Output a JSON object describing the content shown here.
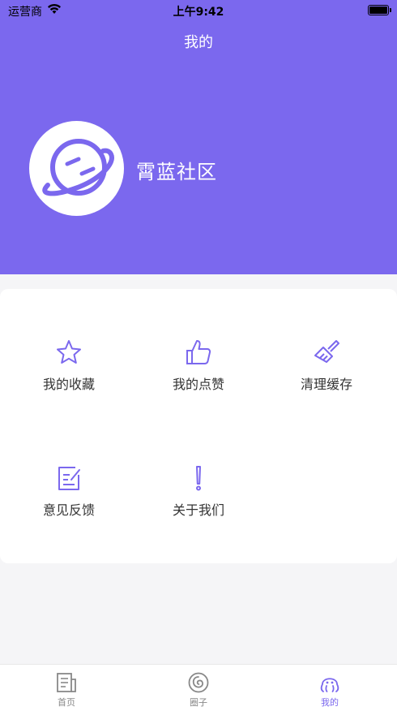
{
  "status_bar": {
    "carrier": "运营商",
    "time": "上午9:42"
  },
  "header": {
    "title": "我的",
    "background_color": "#7b68ee"
  },
  "profile": {
    "name": "霄蓝社区",
    "avatar_icon": "planet-face-icon"
  },
  "menu": {
    "items": [
      {
        "label": "我的收藏",
        "icon": "star-icon"
      },
      {
        "label": "我的点赞",
        "icon": "thumbs-up-icon"
      },
      {
        "label": "清理缓存",
        "icon": "brush-icon"
      },
      {
        "label": "意见反馈",
        "icon": "feedback-icon"
      },
      {
        "label": "关于我们",
        "icon": "exclamation-icon"
      }
    ]
  },
  "tabbar": {
    "active_color": "#7b68ee",
    "tabs": [
      {
        "label": "首页",
        "icon": "news-icon",
        "active": false
      },
      {
        "label": "圈子",
        "icon": "circle-swirl-icon",
        "active": false
      },
      {
        "label": "我的",
        "icon": "octopus-icon",
        "active": true
      }
    ]
  }
}
